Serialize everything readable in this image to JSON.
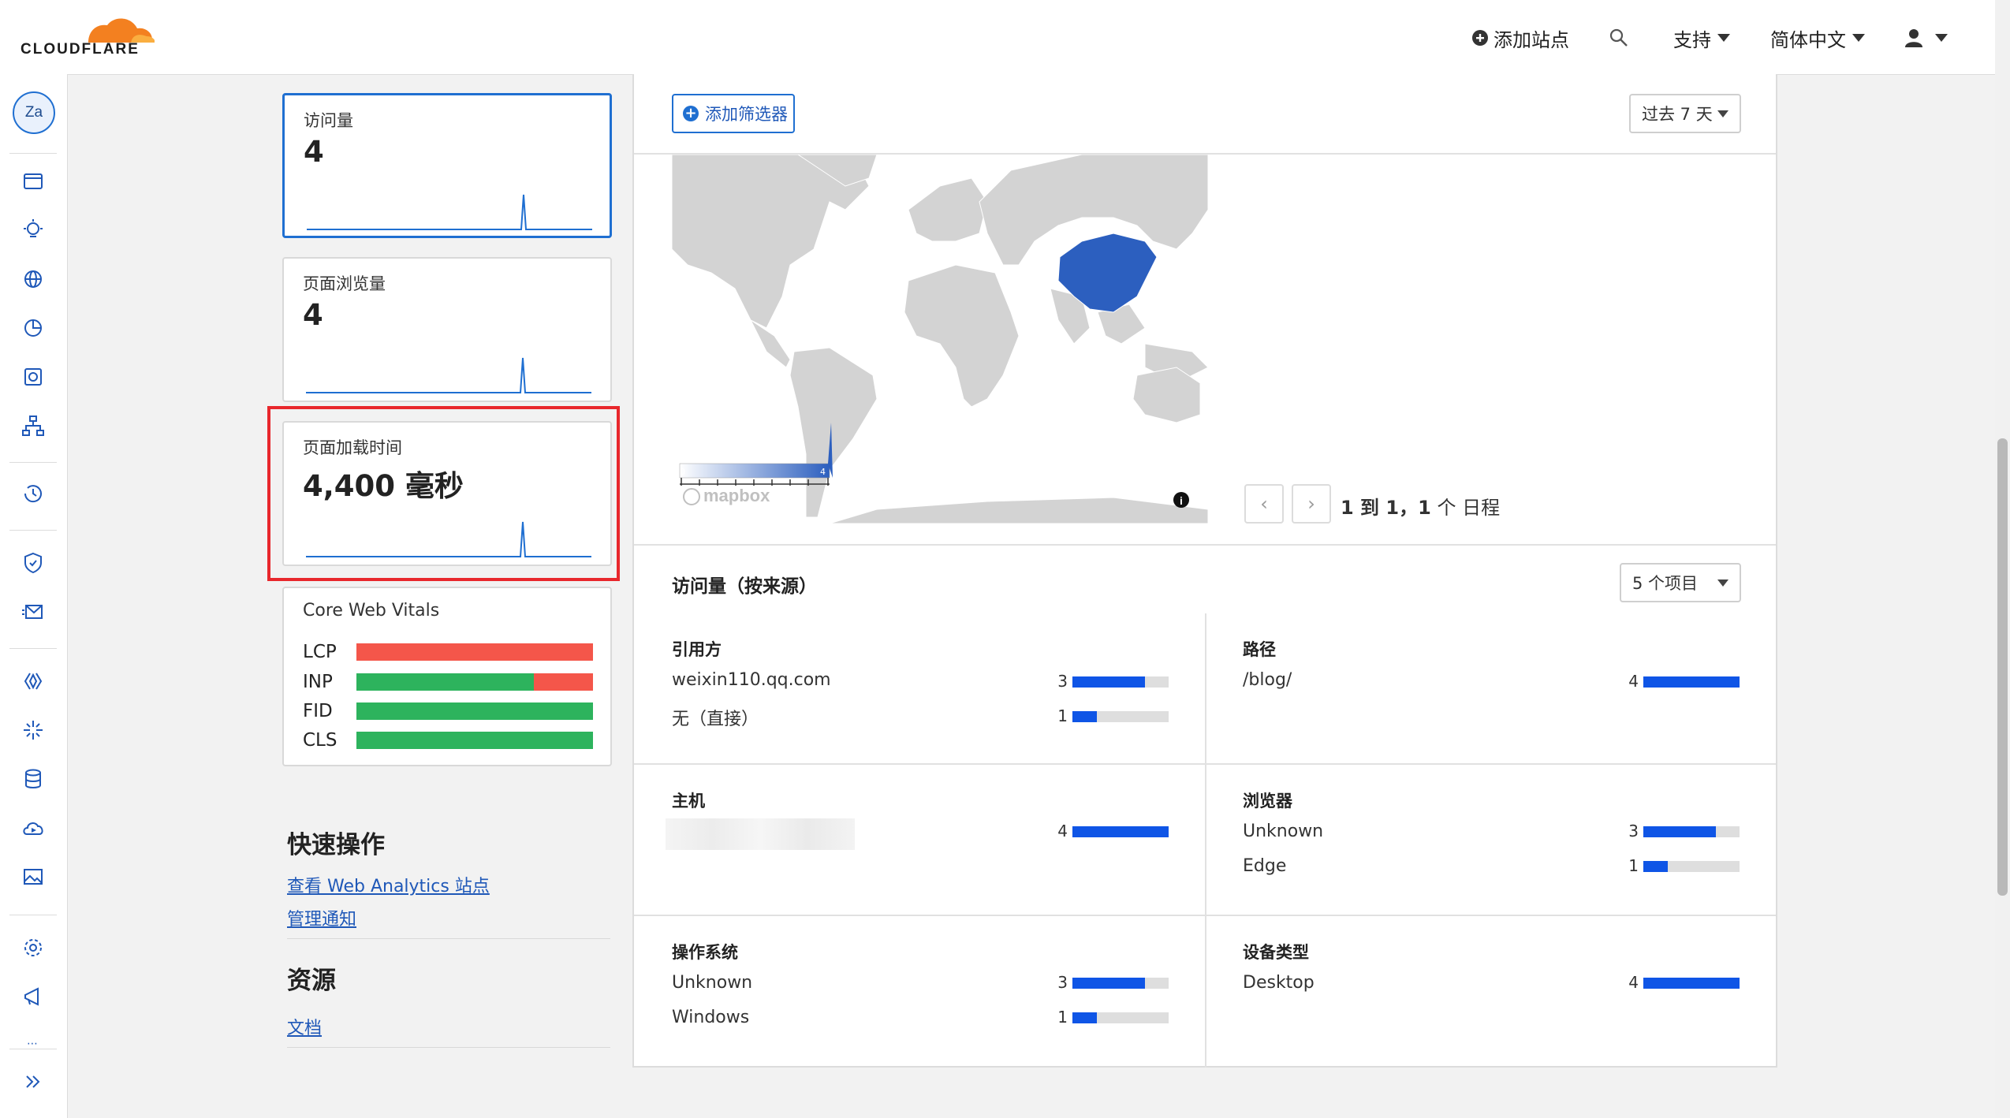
{
  "header": {
    "brand": "CLOUDFLARE",
    "add_site": "添加站点",
    "support": "支持",
    "language": "简体中文"
  },
  "sidebar": {
    "account_initials": "Za"
  },
  "cards": [
    {
      "label": "访问量",
      "value": "4"
    },
    {
      "label": "页面浏览量",
      "value": "4"
    },
    {
      "label": "页面加载时间",
      "value": "4,400 毫秒"
    }
  ],
  "cwv": {
    "title": "Core Web Vitals",
    "metrics": [
      {
        "name": "LCP",
        "good": 0,
        "poor": 1.0
      },
      {
        "name": "INP",
        "good": 0.75,
        "poor": 0.25
      },
      {
        "name": "FID",
        "good": 1.0,
        "poor": 0
      },
      {
        "name": "CLS",
        "good": 1.0,
        "poor": 0
      }
    ],
    "good_color": "#2db35d",
    "poor_color": "#f4564a"
  },
  "quick": {
    "title": "快速操作",
    "link1": "查看 Web Analytics 站点",
    "link2": "管理通知"
  },
  "resources": {
    "title": "资源",
    "link1": "文档"
  },
  "toolbar": {
    "add_filter": "添加筛选器",
    "range": "过去 7 天"
  },
  "map": {
    "legend_min": "0",
    "legend_max": "4",
    "attribution": "mapbox",
    "highlight_color": "#2c5fbf"
  },
  "pager": {
    "text_a": "1",
    "text_b": " 到 ",
    "text_c": "1",
    "text_d": "，",
    "text_e": "1",
    "text_f": " 个 日程"
  },
  "sources": {
    "title": "访问量（按来源）",
    "items_select": "5 个项目",
    "referrer": {
      "title": "引用方",
      "rows": [
        {
          "label": "weixin110.qq.com",
          "value": "3",
          "frac": 0.75
        },
        {
          "label": "无（直接）",
          "value": "1",
          "frac": 0.25
        }
      ]
    },
    "path": {
      "title": "路径",
      "rows": [
        {
          "label": "/blog/",
          "value": "4",
          "frac": 1.0
        }
      ]
    },
    "host": {
      "title": "主机",
      "rows": [
        {
          "label": "",
          "value": "4",
          "frac": 1.0
        }
      ]
    },
    "browser": {
      "title": "浏览器",
      "rows": [
        {
          "label": "Unknown",
          "value": "3",
          "frac": 0.75
        },
        {
          "label": "Edge",
          "value": "1",
          "frac": 0.25
        }
      ]
    },
    "os": {
      "title": "操作系统",
      "rows": [
        {
          "label": "Unknown",
          "value": "3",
          "frac": 0.75
        },
        {
          "label": "Windows",
          "value": "1",
          "frac": 0.25
        }
      ]
    },
    "device": {
      "title": "设备类型",
      "rows": [
        {
          "label": "Desktop",
          "value": "4",
          "frac": 1.0
        }
      ]
    }
  }
}
